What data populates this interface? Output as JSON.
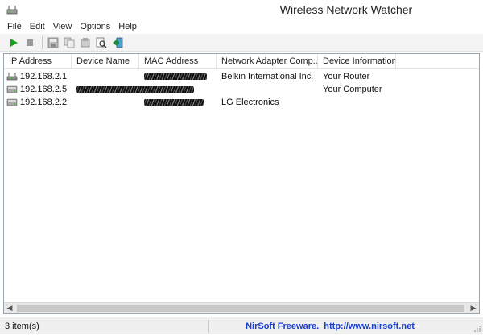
{
  "window": {
    "title": "Wireless Network Watcher"
  },
  "menu": [
    "File",
    "Edit",
    "View",
    "Options",
    "Help"
  ],
  "toolbar": {
    "buttons": [
      "play-icon",
      "stop-icon",
      "save-icon",
      "copy-icon",
      "properties-icon",
      "find-icon",
      "exit-icon"
    ]
  },
  "table": {
    "columns": [
      "IP Address",
      "Device Name",
      "MAC Address",
      "Network Adapter Comp...",
      "Device Information"
    ],
    "rows": [
      {
        "ip": "192.168.2.1",
        "icon": "router-icon",
        "name_redacted": false,
        "mac_redacted": true,
        "adapter": "Belkin International Inc.",
        "info": "Your Router"
      },
      {
        "ip": "192.168.2.5",
        "icon": "computer-icon",
        "name_redacted": true,
        "mac_redacted": true,
        "adapter": "",
        "info": "Your Computer"
      },
      {
        "ip": "192.168.2.2",
        "icon": "computer-icon",
        "name_redacted": false,
        "mac_redacted": true,
        "adapter": "LG Electronics",
        "info": ""
      }
    ]
  },
  "status": {
    "count": "3 item(s)",
    "link": "NirSoft Freeware.  http://www.nirsoft.net"
  },
  "colors": {
    "link": "#1a3fd0",
    "play": "#1aa31a",
    "border": "#9aa7b8"
  }
}
